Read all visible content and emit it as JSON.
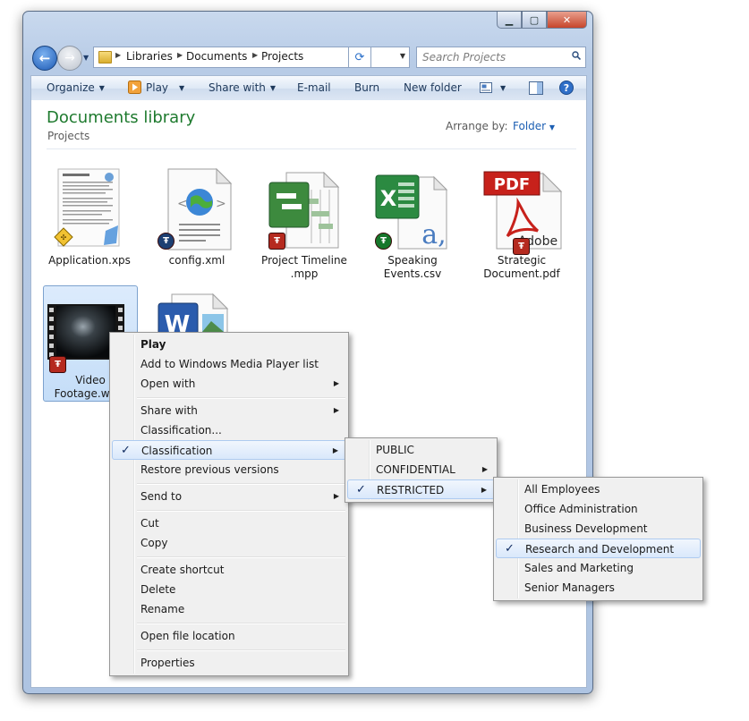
{
  "address": {
    "crumbs": [
      "Libraries",
      "Documents",
      "Projects"
    ]
  },
  "search": {
    "placeholder": "Search Projects"
  },
  "toolbar": {
    "organize": "Organize",
    "play": "Play",
    "share_with": "Share with",
    "email": "E-mail",
    "burn": "Burn",
    "new_folder": "New folder"
  },
  "library": {
    "title": "Documents library",
    "subtitle": "Projects",
    "arrange_label": "Arrange by:",
    "arrange_value": "Folder"
  },
  "files": [
    {
      "name": "Application.xps"
    },
    {
      "name": "config.xml"
    },
    {
      "name": "Project Timeline .mpp"
    },
    {
      "name": "Speaking Events.csv"
    },
    {
      "name": "Strategic Document.pdf"
    },
    {
      "name": "Video Footage.wmv"
    },
    {
      "name": ""
    }
  ],
  "context_menu": {
    "items": [
      "Play",
      "Add to Windows Media Player list",
      "Open with",
      "Share with",
      "Classification...",
      "Classification",
      "Restore previous versions",
      "Send to",
      "Cut",
      "Copy",
      "Create shortcut",
      "Delete",
      "Rename",
      "Open file location",
      "Properties"
    ]
  },
  "classification_menu": {
    "items": [
      "PUBLIC",
      "CONFIDENTIAL",
      "RESTRICTED"
    ]
  },
  "restricted_menu": {
    "items": [
      "All Employees",
      "Office Administration",
      "Business Development",
      "Research and Development",
      "Sales and Marketing",
      "Senior Managers"
    ]
  },
  "icons": {
    "pdf_text": "PDF",
    "pdf_brand": "Adobe",
    "word_letter": "W",
    "excel_letter": "X",
    "csv_letter": "a,"
  },
  "colors": {
    "library_title": "#1e7a2e",
    "link": "#1c5fb3",
    "rms_red": "#b52a1f"
  }
}
